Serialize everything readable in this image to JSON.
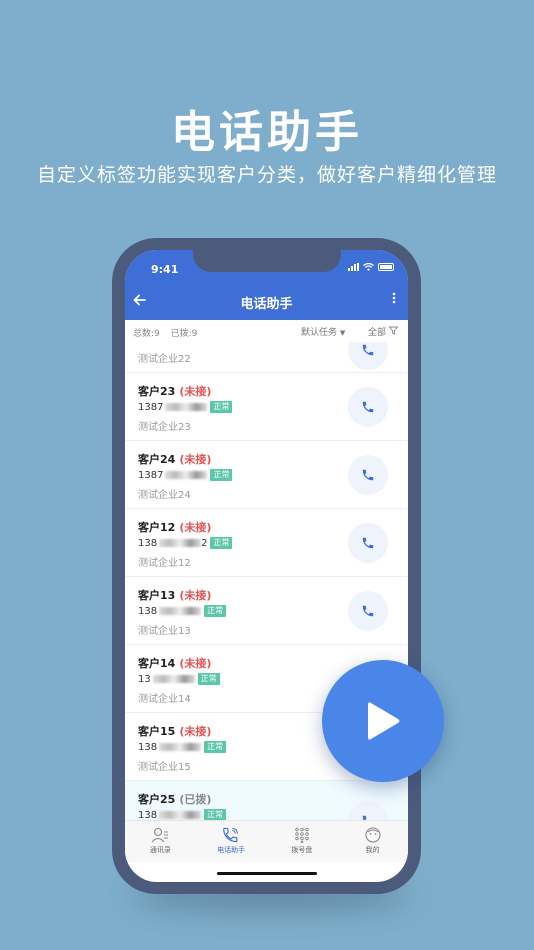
{
  "hero": {
    "title": "电话助手",
    "subtitle": "自定义标签功能实现客户分类，做好客户精细化管理"
  },
  "status_bar": {
    "time": "9:41"
  },
  "nav": {
    "back_icon": "arrow-left-icon",
    "title": "电话助手",
    "more_icon": "more-vertical-icon"
  },
  "filter": {
    "total": "总数:9",
    "dialed": "已拨:9",
    "task": "默认任务",
    "all": "全部"
  },
  "list": {
    "partial_company": "测试企业22",
    "items": [
      {
        "name": "客户23",
        "state": "(未接)",
        "phone_prefix": "1387",
        "phone_suffix": "",
        "tag": "正常",
        "company": "测试企业23"
      },
      {
        "name": "客户24",
        "state": "(未接)",
        "phone_prefix": "1387",
        "phone_suffix": "",
        "tag": "正常",
        "company": "测试企业24"
      },
      {
        "name": "客户12",
        "state": "(未接)",
        "phone_prefix": "138",
        "phone_suffix": "2",
        "tag": "正常",
        "company": "测试企业12"
      },
      {
        "name": "客户13",
        "state": "(未接)",
        "phone_prefix": "138",
        "phone_suffix": "",
        "tag": "正常",
        "company": "测试企业13"
      },
      {
        "name": "客户14",
        "state": "(未接)",
        "phone_prefix": "13",
        "phone_suffix": "",
        "tag": "正常",
        "company": "测试企业14"
      },
      {
        "name": "客户15",
        "state": "(未接)",
        "phone_prefix": "138",
        "phone_suffix": "",
        "tag": "正常",
        "company": "测试企业15"
      },
      {
        "name": "客户25",
        "state": "(已拨)",
        "phone_prefix": "138",
        "phone_suffix": "",
        "tag": "正常",
        "company": ""
      }
    ]
  },
  "tabs": [
    {
      "label": "通讯录",
      "icon": "contacts-icon"
    },
    {
      "label": "电话助手",
      "icon": "phone-icon"
    },
    {
      "label": "拨号盘",
      "icon": "dialpad-icon"
    },
    {
      "label": "我的",
      "icon": "profile-icon"
    }
  ],
  "colors": {
    "background": "#7eaecb",
    "primary": "#3d6fd6",
    "missed": "#e25555",
    "dialed": "#888888",
    "tag": "#5cc6a8",
    "fab": "#4a86e8"
  },
  "fab": {
    "icon": "play-icon"
  }
}
